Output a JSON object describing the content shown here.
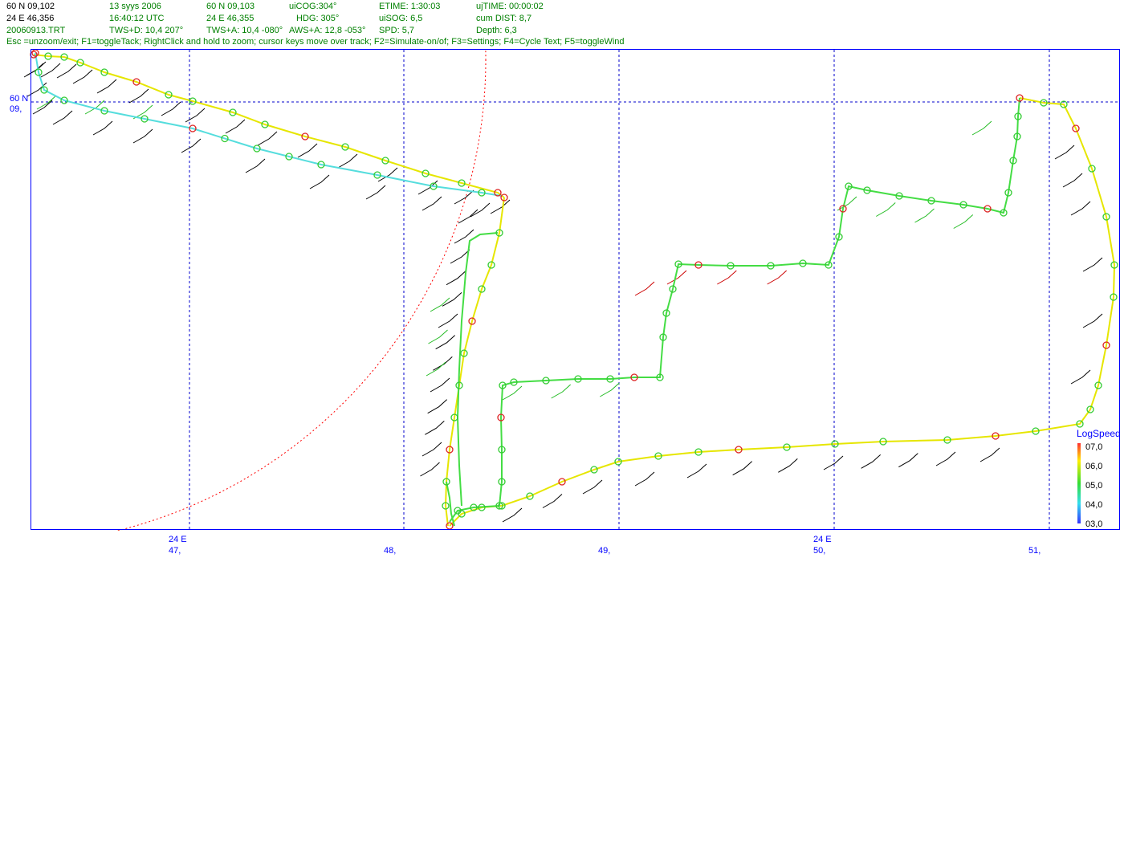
{
  "header": {
    "row1": [
      "60 N 09,102",
      "13 syys 2006",
      "60 N 09,103",
      "uiCOG:304°",
      "ETIME: 1:30:03",
      "ujTIME: 00:00:02"
    ],
    "row2": [
      "24 E 46,356",
      "16:40:12  UTC",
      "24 E 46,355",
      "HDG: 305°",
      "uiSOG: 6,5",
      "cum DIST: 8,7"
    ],
    "row3": [
      "20060913.TRT",
      "TWS+D: 10,4 207°",
      "TWS+A: 10,4 -080°",
      "AWS+A: 12,8 -053°",
      "SPD: 5,7",
      "Depth: 6,3"
    ]
  },
  "helpline": "Esc =unzoom/exit; F1=toggleTack; RightClick and hold to zoom; cursor keys move over track; F2=Simulate-on/of; F3=Settings; F4=Cycle Text; F5=toggleWind",
  "axis": {
    "y_label_top": "60 N",
    "y_label_bottom": "09,",
    "x_labels": [
      {
        "deg": "24 E",
        "min": "47,"
      },
      {
        "deg": "",
        "min": "48,"
      },
      {
        "deg": "",
        "min": "49,"
      },
      {
        "deg": "24 E",
        "min": "50,"
      },
      {
        "deg": "",
        "min": "51,"
      }
    ]
  },
  "legend": {
    "title": "LogSpeed",
    "values": [
      "07,0",
      "06,0",
      "05,0",
      "04,0",
      "03,0"
    ]
  },
  "colors": {
    "frame": "#0000ff",
    "grid": "#0000cc",
    "radius": "#ff0000",
    "track_yellow": "#e6e600",
    "track_green": "#44dd44",
    "marker_green": "#33cc33",
    "marker_red": "#dd2222",
    "wind_black": "#000000",
    "wind_green": "#22bb22",
    "wind_red": "#cc0000"
  }
}
